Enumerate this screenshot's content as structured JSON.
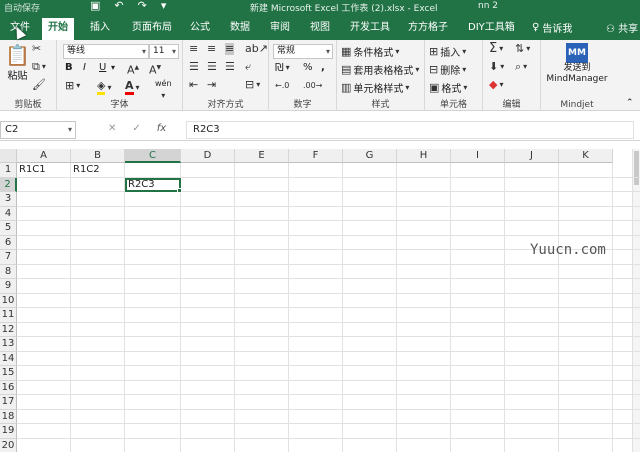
{
  "titlebar": {
    "autosave": "自动保存",
    "doc_title": "新建 Microsoft Excel 工作表 (2).xlsx - Excel",
    "user": "nn 2"
  },
  "tabs": [
    {
      "label": "文件"
    },
    {
      "label": "开始"
    },
    {
      "label": "插入"
    },
    {
      "label": "页面布局"
    },
    {
      "label": "公式"
    },
    {
      "label": "数据"
    },
    {
      "label": "审阅"
    },
    {
      "label": "视图"
    },
    {
      "label": "开发工具"
    },
    {
      "label": "方方格子"
    },
    {
      "label": "DIY工具箱"
    }
  ],
  "tell_me": "告诉我",
  "share": "共享",
  "ribbon": {
    "clipboard": {
      "label": "剪贴板",
      "paste": "粘贴"
    },
    "font": {
      "label": "字体",
      "name": "等线",
      "size": "11",
      "bold": "B",
      "italic": "I",
      "underline": "U",
      "fontcolor": "A",
      "wen": "wén"
    },
    "alignment": {
      "label": "对齐方式"
    },
    "number": {
      "label": "数字",
      "format": "常规",
      "percent": "%",
      "comma": ","
    },
    "styles": {
      "label": "样式",
      "conditional": "条件格式",
      "table": "套用表格格式",
      "cell_styles": "单元格样式"
    },
    "cells": {
      "label": "单元格",
      "insert": "插入",
      "delete": "删除",
      "format": "格式"
    },
    "editing": {
      "label": "编辑"
    },
    "mindjet": {
      "label": "Mindjet",
      "send_line1": "发送到",
      "send_line2": "MindManager"
    }
  },
  "formula_bar": {
    "name_box": "C2",
    "content": "R2C3",
    "fx": "fx"
  },
  "sheet": {
    "columns": [
      "A",
      "B",
      "C",
      "D",
      "E",
      "F",
      "G",
      "H",
      "I",
      "J",
      "K"
    ],
    "rows": [
      "1",
      "2",
      "3",
      "4",
      "5",
      "6",
      "7",
      "8",
      "9",
      "10",
      "11",
      "12",
      "13",
      "14",
      "15",
      "16",
      "17",
      "18",
      "19",
      "20"
    ],
    "selected_col": "C",
    "selected_row": "2",
    "cells": {
      "A1": "R1C1",
      "B1": "R1C2",
      "C2": "R2C3"
    }
  },
  "watermark": "Yuucn.com"
}
